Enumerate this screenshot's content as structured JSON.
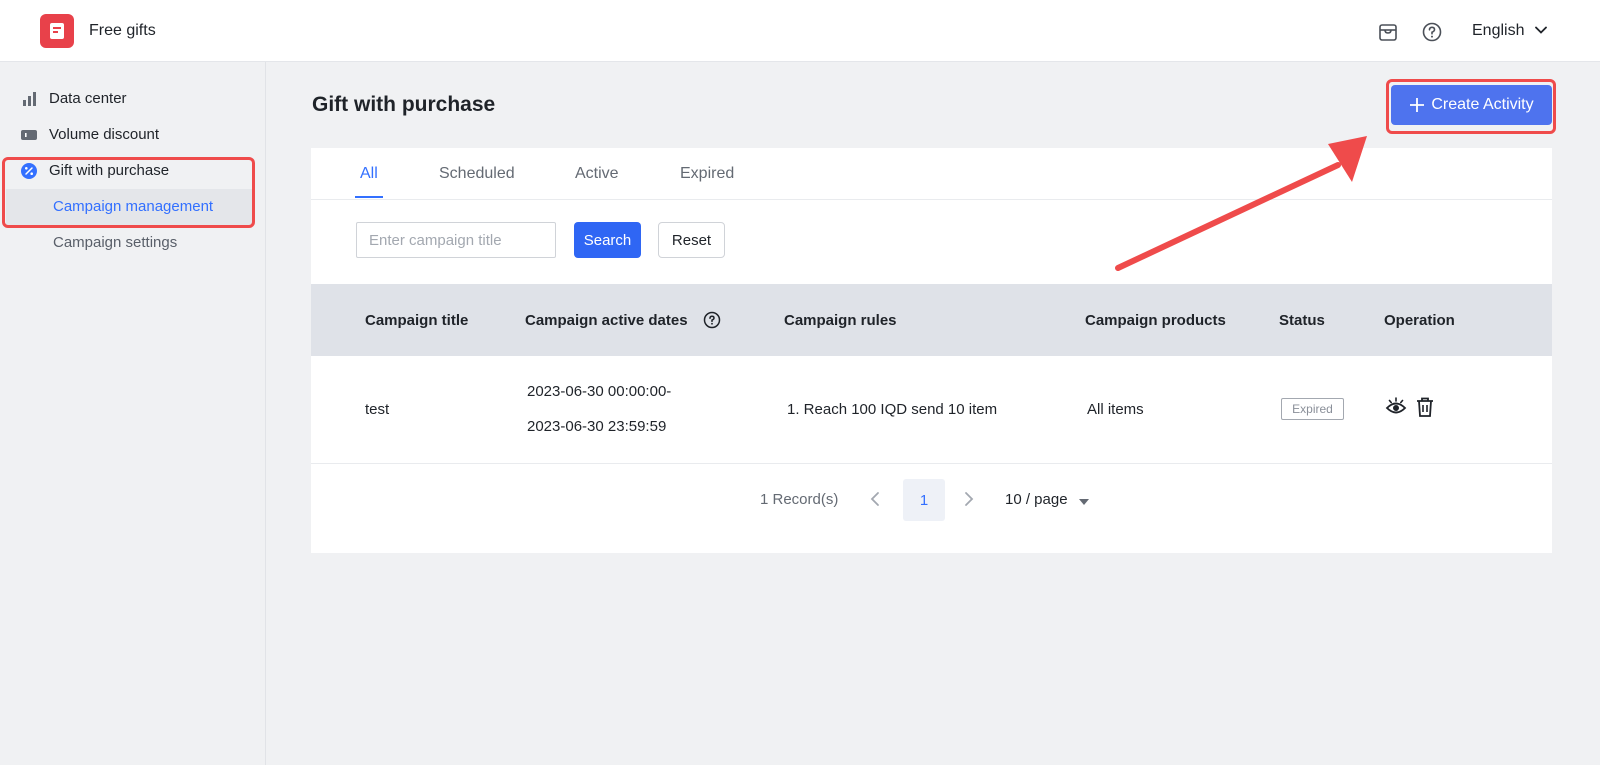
{
  "header": {
    "app_name": "Free gifts",
    "language": "English",
    "icons": [
      "store-icon",
      "help-icon",
      "chevron-down-icon"
    ]
  },
  "sidebar": {
    "items": [
      {
        "label": "Data center",
        "icon": "bar-chart-icon"
      },
      {
        "label": "Volume discount",
        "icon": "ticket-icon"
      },
      {
        "label": "Gift with purchase",
        "icon": "percent-badge-icon"
      },
      {
        "label": "Campaign management",
        "active": true
      },
      {
        "label": "Campaign settings"
      }
    ]
  },
  "main": {
    "title": "Gift with purchase",
    "create_button": "Create Activity",
    "tabs": [
      {
        "label": "All",
        "active": true
      },
      {
        "label": "Scheduled"
      },
      {
        "label": "Active"
      },
      {
        "label": "Expired"
      }
    ],
    "search": {
      "placeholder": "Enter campaign title",
      "value": "",
      "search_label": "Search",
      "reset_label": "Reset"
    },
    "table": {
      "columns": [
        "Campaign title",
        "Campaign active dates",
        "Campaign rules",
        "Campaign products",
        "Status",
        "Operation"
      ],
      "rows": [
        {
          "title": "test",
          "date_start": "2023-06-30 00:00:00-",
          "date_end": "2023-06-30 23:59:59",
          "rules": "1. Reach 100 IQD send 10 item",
          "products": "All items",
          "status": "Expired"
        }
      ]
    },
    "pagination": {
      "total": "1 Record(s)",
      "current_page": "1",
      "page_size": "10 / page"
    }
  },
  "colors": {
    "primary": "#3370ff",
    "create_button": "#4e73ee",
    "highlight": "#ef4b4b",
    "logo": "#e8414a"
  }
}
